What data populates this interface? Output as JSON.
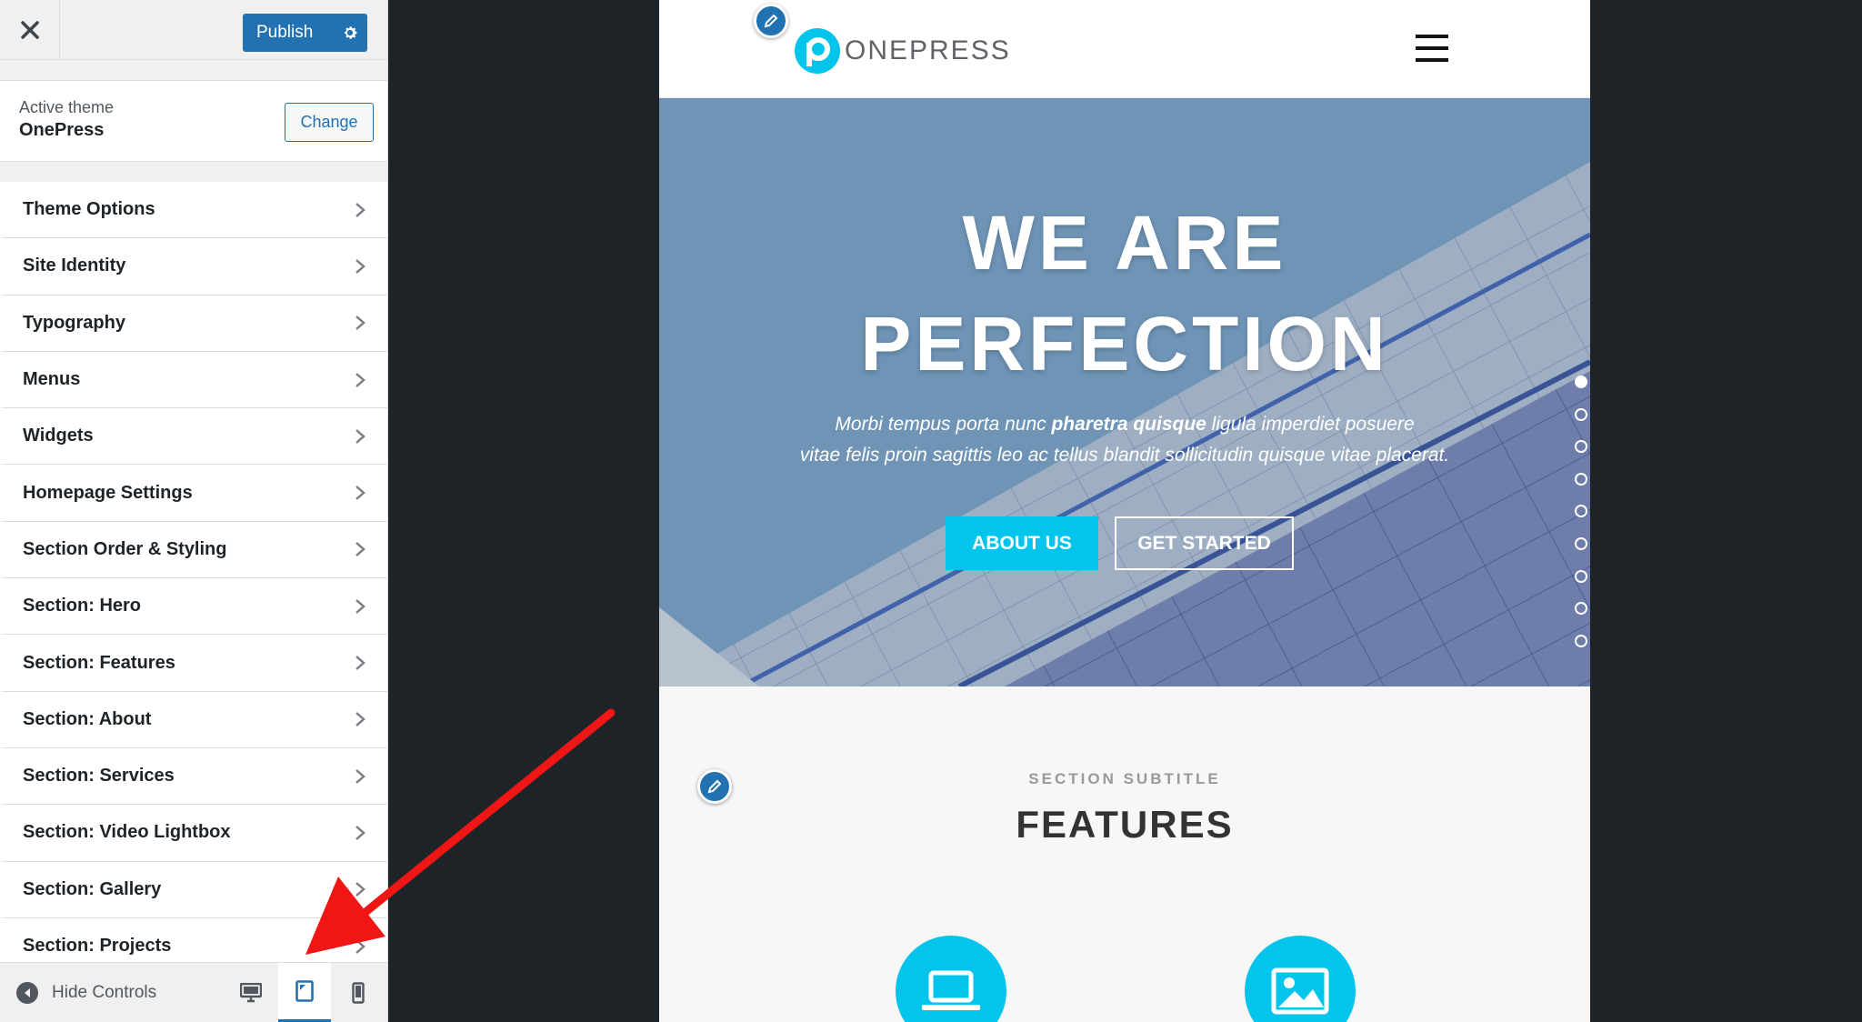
{
  "customizer": {
    "close_icon": "close-icon",
    "publish_label": "Publish",
    "active_theme_caption": "Active theme",
    "active_theme_name": "OnePress",
    "change_label": "Change",
    "menu": [
      {
        "label": "Theme Options"
      },
      {
        "label": "Site Identity"
      },
      {
        "label": "Typography"
      },
      {
        "label": "Menus"
      },
      {
        "label": "Widgets"
      },
      {
        "label": "Homepage Settings"
      },
      {
        "label": "Section Order & Styling"
      },
      {
        "label": "Section: Hero"
      },
      {
        "label": "Section: Features"
      },
      {
        "label": "Section: About"
      },
      {
        "label": "Section: Services"
      },
      {
        "label": "Section: Video Lightbox"
      },
      {
        "label": "Section: Gallery"
      },
      {
        "label": "Section: Projects"
      }
    ],
    "hide_controls_label": "Hide Controls",
    "devices": [
      "desktop",
      "tablet",
      "mobile"
    ],
    "active_device": "tablet",
    "accent_color": "#2271b1"
  },
  "preview": {
    "logo_text": "ONEPRESS",
    "hero": {
      "title_line1": "WE ARE",
      "title_line2": "PERFECTION",
      "desc_part1": "Morbi tempus porta nunc ",
      "desc_bold": "pharetra quisque",
      "desc_part2": " ligula imperdiet posuere",
      "desc_line2": "vitae felis proin sagittis leo ac tellus blandit sollicitudin quisque vitae placerat.",
      "btn_primary": "ABOUT US",
      "btn_secondary": "GET STARTED",
      "slide_count": 9,
      "active_slide": 1
    },
    "features": {
      "subtitle": "SECTION SUBTITLE",
      "title": "FEATURES",
      "icons": [
        "laptop-icon",
        "image-icon"
      ]
    },
    "brand_color": "#03c4eb"
  }
}
